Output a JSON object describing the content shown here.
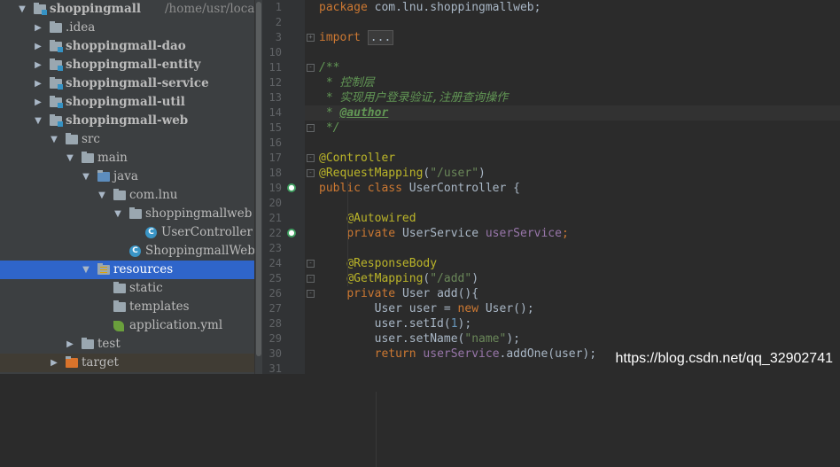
{
  "project_tree": {
    "items": [
      {
        "label": "shoppingmall",
        "path": "/home/usr/local/I",
        "depth": 0,
        "arrow": "▼",
        "icon": "module-folder-icon",
        "bold": true
      },
      {
        "label": ".idea",
        "depth": 1,
        "arrow": "▶",
        "icon": "folder-icon"
      },
      {
        "label": "shoppingmall-dao",
        "depth": 1,
        "arrow": "▶",
        "icon": "module-folder-icon",
        "bold": true
      },
      {
        "label": "shoppingmall-entity",
        "depth": 1,
        "arrow": "▶",
        "icon": "module-folder-icon",
        "bold": true
      },
      {
        "label": "shoppingmall-service",
        "depth": 1,
        "arrow": "▶",
        "icon": "module-folder-icon",
        "bold": true
      },
      {
        "label": "shoppingmall-util",
        "depth": 1,
        "arrow": "▶",
        "icon": "module-folder-icon",
        "bold": true
      },
      {
        "label": "shoppingmall-web",
        "depth": 1,
        "arrow": "▼",
        "icon": "module-folder-icon",
        "bold": true
      },
      {
        "label": "src",
        "depth": 2,
        "arrow": "▼",
        "icon": "folder-icon"
      },
      {
        "label": "main",
        "depth": 3,
        "arrow": "▼",
        "icon": "folder-icon"
      },
      {
        "label": "java",
        "depth": 4,
        "arrow": "▼",
        "icon": "source-folder-icon"
      },
      {
        "label": "com.lnu",
        "depth": 5,
        "arrow": "▼",
        "icon": "package-icon"
      },
      {
        "label": "shoppingmallweb",
        "depth": 6,
        "arrow": "▼",
        "icon": "package-icon"
      },
      {
        "label": "UserController",
        "depth": 7,
        "arrow": "",
        "icon": "class-icon"
      },
      {
        "label": "ShoppingmallWebAppl",
        "depth": 6,
        "arrow": "",
        "icon": "spring-boot-class-icon"
      },
      {
        "label": "resources",
        "depth": 4,
        "arrow": "▼",
        "icon": "resources-folder-icon",
        "selected": true
      },
      {
        "label": "static",
        "depth": 5,
        "arrow": "",
        "icon": "folder-icon"
      },
      {
        "label": "templates",
        "depth": 5,
        "arrow": "",
        "icon": "folder-icon"
      },
      {
        "label": "application.yml",
        "depth": 5,
        "arrow": "",
        "icon": "spring-config-icon"
      },
      {
        "label": "test",
        "depth": 3,
        "arrow": "▶",
        "icon": "folder-icon"
      },
      {
        "label": "target",
        "depth": 2,
        "arrow": "▶",
        "icon": "excluded-folder-icon"
      }
    ]
  },
  "editor": {
    "lines": [
      {
        "n": "1",
        "tokens": [
          [
            "kw",
            "package"
          ],
          [
            "t",
            " com.lnu.shoppingmallweb;"
          ]
        ]
      },
      {
        "n": "2",
        "tokens": []
      },
      {
        "n": "3",
        "tokens": [
          [
            "kw",
            "import"
          ],
          [
            "t",
            " "
          ],
          [
            "fold",
            "..."
          ]
        ],
        "fold": "+"
      },
      {
        "n": "10",
        "tokens": []
      },
      {
        "n": "11",
        "tokens": [
          [
            "cm",
            "/**"
          ]
        ],
        "fold": "-"
      },
      {
        "n": "12",
        "tokens": [
          [
            "cm",
            " * 控制层"
          ]
        ]
      },
      {
        "n": "13",
        "tokens": [
          [
            "cm",
            " * 实现用户登录验证,注册查询操作"
          ]
        ]
      },
      {
        "n": "14",
        "tokens": [
          [
            "cm",
            " * "
          ],
          [
            "tag",
            "@author"
          ]
        ],
        "highlight": true
      },
      {
        "n": "15",
        "tokens": [
          [
            "cm",
            " */"
          ]
        ],
        "fold": "-"
      },
      {
        "n": "16",
        "tokens": []
      },
      {
        "n": "17",
        "tokens": [
          [
            "ann",
            "@Controller"
          ]
        ],
        "fold": "-"
      },
      {
        "n": "18",
        "tokens": [
          [
            "ann",
            "@RequestMapping"
          ],
          [
            "t",
            "("
          ],
          [
            "str",
            "\"/user\""
          ],
          [
            "t",
            ")"
          ]
        ],
        "fold": "-"
      },
      {
        "n": "19",
        "tokens": [
          [
            "kw",
            "public class "
          ],
          [
            "t",
            "UserController {"
          ]
        ],
        "gicon": "spring-bean-icon"
      },
      {
        "n": "20",
        "tokens": []
      },
      {
        "n": "21",
        "tokens": [
          [
            "t",
            "    "
          ],
          [
            "ann",
            "@Autowired"
          ]
        ]
      },
      {
        "n": "22",
        "tokens": [
          [
            "t",
            "    "
          ],
          [
            "kw",
            "private "
          ],
          [
            "t",
            "UserService "
          ],
          [
            "fld",
            "userService"
          ],
          [
            "kw",
            ";"
          ]
        ],
        "gicon": "autowired-icon"
      },
      {
        "n": "23",
        "tokens": []
      },
      {
        "n": "24",
        "tokens": [
          [
            "t",
            "    "
          ],
          [
            "ann",
            "@ResponseBody"
          ]
        ],
        "fold": "-"
      },
      {
        "n": "25",
        "tokens": [
          [
            "t",
            "    "
          ],
          [
            "ann",
            "@GetMapping"
          ],
          [
            "t",
            "("
          ],
          [
            "str",
            "\"/add\""
          ],
          [
            "t",
            ")"
          ]
        ],
        "fold": "-"
      },
      {
        "n": "26",
        "tokens": [
          [
            "t",
            "    "
          ],
          [
            "kw",
            "private "
          ],
          [
            "t",
            "User "
          ],
          [
            "t",
            "add"
          ],
          [
            "t",
            "(){"
          ]
        ],
        "fold": "-"
      },
      {
        "n": "27",
        "tokens": [
          [
            "t",
            "        User user = "
          ],
          [
            "kw",
            "new "
          ],
          [
            "t",
            "User();"
          ]
        ]
      },
      {
        "n": "28",
        "tokens": [
          [
            "t",
            "        user.setId("
          ],
          [
            "num",
            "1"
          ],
          [
            "t",
            ");"
          ]
        ]
      },
      {
        "n": "29",
        "tokens": [
          [
            "t",
            "        user.setName("
          ],
          [
            "str",
            "\"name\""
          ],
          [
            "t",
            ");"
          ]
        ]
      },
      {
        "n": "30",
        "tokens": [
          [
            "t",
            "        "
          ],
          [
            "kw",
            "return "
          ],
          [
            "fld",
            "userService"
          ],
          [
            "t",
            ".addOne(user);"
          ]
        ]
      },
      {
        "n": "31",
        "tokens": []
      }
    ]
  },
  "watermark": "https://blog.csdn.net/qq_32902741"
}
